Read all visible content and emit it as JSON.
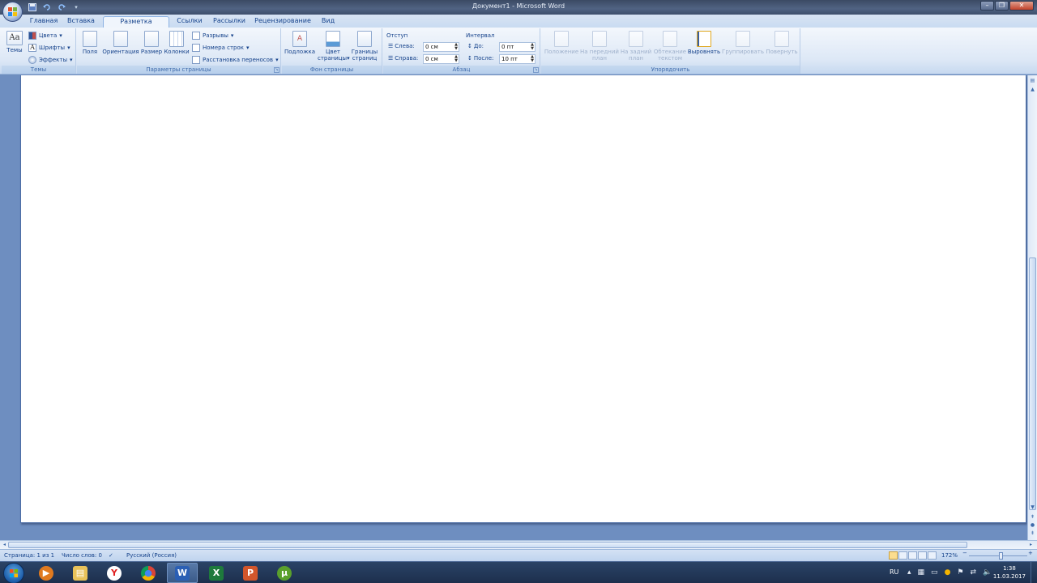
{
  "window": {
    "title": "Документ1 - Microsoft Word",
    "controls": {
      "minimize": "–",
      "maximize": "❐",
      "close": "✕"
    }
  },
  "quick_access": [
    {
      "icon": "save-icon",
      "glyph": "💾"
    },
    {
      "icon": "undo-icon",
      "glyph": "↶"
    },
    {
      "icon": "redo-icon",
      "glyph": "↻"
    },
    {
      "icon": "customize-icon",
      "glyph": "▾"
    }
  ],
  "tabs": [
    {
      "label": "Главная",
      "active": false
    },
    {
      "label": "Вставка",
      "active": false
    },
    {
      "label": "Разметка страницы",
      "active": true
    },
    {
      "label": "Ссылки",
      "active": false
    },
    {
      "label": "Рассылки",
      "active": false
    },
    {
      "label": "Рецензирование",
      "active": false
    },
    {
      "label": "Вид",
      "active": false
    }
  ],
  "ribbon": {
    "themes": {
      "group_label": "Темы",
      "themes_label": "Темы",
      "colors_label": "Цвета",
      "fonts_label": "Шрифты",
      "effects_label": "Эффекты"
    },
    "page_setup": {
      "group_label": "Параметры страницы",
      "margins_label": "Поля",
      "orientation_label": "Ориентация",
      "size_label": "Размер",
      "columns_label": "Колонки",
      "breaks_label": "Разрывы",
      "line_numbers_label": "Номера строк",
      "hyphenation_label": "Расстановка переносов"
    },
    "page_background": {
      "group_label": "Фон страницы",
      "watermark_label": "Подложка",
      "page_color_label_1": "Цвет",
      "page_color_label_2": "страницы",
      "page_borders_label_1": "Границы",
      "page_borders_label_2": "страниц"
    },
    "paragraph": {
      "group_label": "Абзац",
      "indent_title": "Отступ",
      "left_label": "Слева:",
      "left_value": "0 см",
      "right_label": "Справа:",
      "right_value": "0 см",
      "spacing_title": "Интервал",
      "before_label": "До:",
      "before_value": "0 пт",
      "after_label": "После:",
      "after_value": "10 пт"
    },
    "arrange": {
      "group_label": "Упорядочить",
      "position_label": "Положение",
      "bring_front_label_1": "На передний",
      "bring_front_label_2": "план",
      "send_back_label_1": "На задний",
      "send_back_label_2": "план",
      "wrap_label_1": "Обтекание",
      "wrap_label_2": "текстом",
      "align_label": "Выровнять",
      "group_label_btn": "Группировать",
      "rotate_label": "Повернуть"
    }
  },
  "status_bar": {
    "page": "Страница: 1 из 1",
    "words": "Число слов: 0",
    "language": "Русский (Россия)",
    "zoom": "172%",
    "zoom_out": "−",
    "zoom_in": "+"
  },
  "taskbar": {
    "apps": [
      {
        "name": "media-player",
        "glyph": "▶",
        "color": "#e07a1f"
      },
      {
        "name": "file-explorer",
        "glyph": "▤",
        "color": "#e8c25a"
      },
      {
        "name": "yandex-browser",
        "glyph": "Y",
        "color": "#e02020"
      },
      {
        "name": "chrome",
        "glyph": "●",
        "color": "#3a8a3a"
      },
      {
        "name": "word",
        "glyph": "W",
        "color": "#2b5fb4"
      },
      {
        "name": "excel",
        "glyph": "X",
        "color": "#1e7a3c"
      },
      {
        "name": "powerpoint",
        "glyph": "P",
        "color": "#d2562b"
      },
      {
        "name": "utorrent",
        "glyph": "µ",
        "color": "#5aa02c"
      }
    ],
    "language": "RU",
    "time": "1:38",
    "date": "11.03.2017"
  },
  "colors": {
    "ribbon_text": "#15428b",
    "doc_background": "#6e8ec0",
    "active_tab": "#f0f5fc"
  }
}
